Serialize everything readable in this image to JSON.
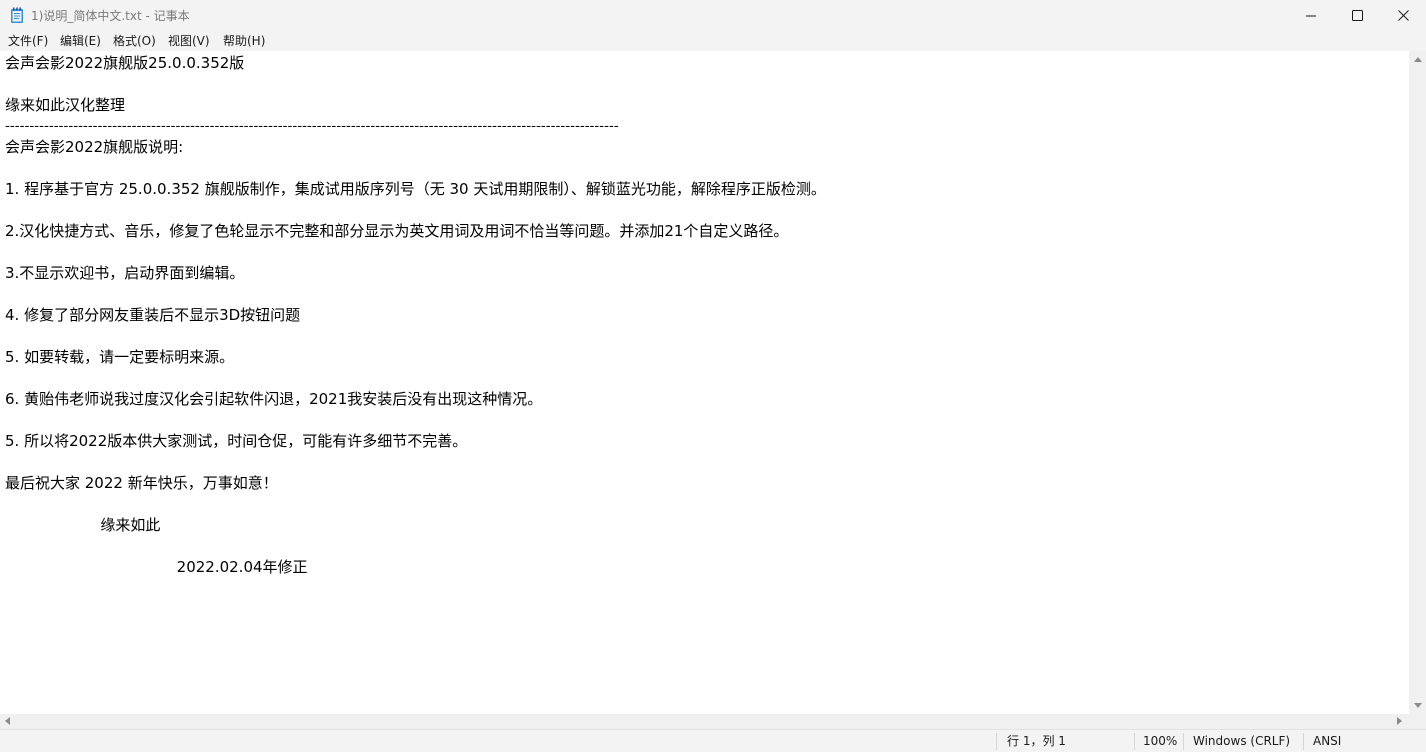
{
  "window": {
    "title": "1)说明_简体中文.txt - 记事本"
  },
  "menu": [
    "文件(F)",
    "编辑(E)",
    "格式(O)",
    "视图(V)",
    "帮助(H)"
  ],
  "editor": {
    "lines": [
      "会声会影2022旗舰版25.0.0.352版",
      "",
      "缘来如此汉化整理",
      "------------------------------------------------------------------------------------------------------------------------------",
      "会声会影2022旗舰版说明:",
      "",
      "1. 程序基于官方 25.0.0.352 旗舰版制作，集成试用版序列号（无 30 天试用期限制）、解锁蓝光功能，解除程序正版检测。",
      "",
      "2.汉化快捷方式、音乐，修复了色轮显示不完整和部分显示为英文用词及用词不恰当等问题。并添加21个自定义路径。",
      "",
      "3.不显示欢迎书，启动界面到编辑。",
      "",
      "4. 修复了部分网友重装后不显示3D按钮问题",
      "",
      "5. 如要转载，请一定要标明来源。",
      "",
      "6. 黄贻伟老师说我过度汉化会引起软件闪退，2021我安装后没有出现这种情况。",
      "",
      "5. 所以将2022版本供大家测试，时间仓促，可能有许多细节不完善。",
      "",
      "最后祝大家 2022 新年快乐，万事如意！",
      "",
      "                    缘来如此",
      "",
      "                                    2022.02.04年修正"
    ]
  },
  "status": {
    "position": "行 1，列 1",
    "zoom": "100%",
    "line_ending": "Windows (CRLF)",
    "encoding": "ANSI"
  }
}
